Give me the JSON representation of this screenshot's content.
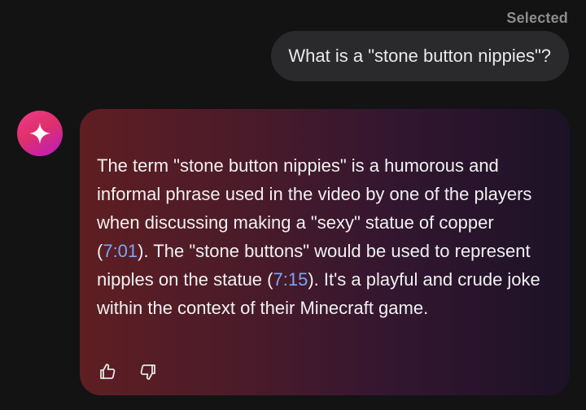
{
  "header": {
    "selected_label": "Selected"
  },
  "user_message": {
    "text": "What is a \"stone button nippies\"?"
  },
  "assistant": {
    "avatar_icon": "sparkle-icon",
    "segments": {
      "s1": "The term \"stone button nippies\" is a humorous and informal phrase used in the video by one of the players when discussing making a \"sexy\" statue of copper (",
      "t1": "7:01",
      "s2": "). The \"stone buttons\" would be used to represent nipples on the statue (",
      "t2": "7:15",
      "s3": "). It's a playful and crude joke within the context of their Minecraft game."
    },
    "feedback": {
      "like_icon": "thumbs-up-icon",
      "dislike_icon": "thumbs-down-icon"
    }
  },
  "colors": {
    "background": "#131314",
    "user_bubble": "#2a2a2c",
    "link": "#7aa7f5",
    "avatar_start": "#ee3a8c",
    "avatar_end": "#b81cc4"
  }
}
